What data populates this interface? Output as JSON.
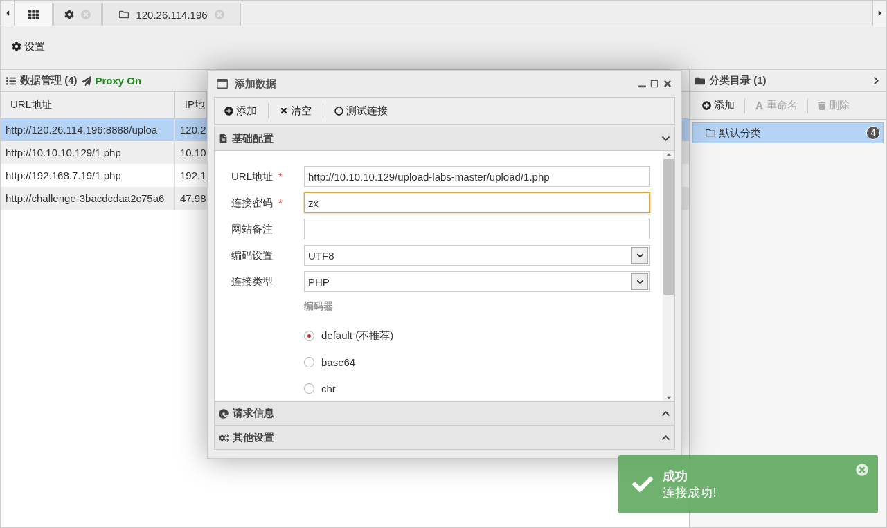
{
  "tabs": [
    {
      "kind": "home",
      "selected": true
    },
    {
      "kind": "settings",
      "selected": false,
      "closable": true
    },
    {
      "kind": "folder",
      "label": "120.26.114.196",
      "selected": false,
      "closable": true
    }
  ],
  "toolbar": {
    "buttons": [
      {
        "label": "设置"
      }
    ]
  },
  "data_panel": {
    "title": "数据管理 (4)",
    "proxy": "Proxy On",
    "columns": [
      "URL地址",
      "IP地"
    ],
    "rows": [
      {
        "cells": [
          "http://120.26.114.196:8888/uploa",
          "120.2"
        ],
        "selected": true
      },
      {
        "cells": [
          "http://10.10.10.129/1.php",
          "10.10"
        ],
        "selected": false
      },
      {
        "cells": [
          "http://192.168.7.19/1.php",
          "192.1"
        ],
        "selected": false
      },
      {
        "cells": [
          "http://challenge-3bacdcdaa2c75a6",
          "47.98"
        ],
        "selected": false
      }
    ]
  },
  "dialog": {
    "title": "添加数据",
    "toolbar": [
      {
        "kind": "add",
        "label": "添加"
      },
      {
        "kind": "clear",
        "label": "清空"
      },
      {
        "kind": "test",
        "label": "测试连接"
      }
    ],
    "sections": [
      {
        "kind": "file",
        "title": "基础配置",
        "expanded": true
      },
      {
        "kind": "request",
        "title": "请求信息",
        "expanded": false
      },
      {
        "kind": "gears",
        "title": "其他设置",
        "expanded": false
      }
    ],
    "fields": [
      {
        "kind": "text",
        "label": "URL地址",
        "required_mark": "*",
        "value": "http://10.10.10.129/upload-labs-master/upload/1.php",
        "focused": false
      },
      {
        "kind": "text",
        "label": "连接密码",
        "required_mark": "*",
        "value": "zx",
        "focused": true
      },
      {
        "kind": "text",
        "label": "网站备注",
        "focused": false
      },
      {
        "kind": "select",
        "label": "编码设置",
        "value": "UTF8",
        "focused": false
      },
      {
        "kind": "select",
        "label": "连接类型",
        "value": "PHP",
        "focused": false
      }
    ],
    "encoder": {
      "label": "编码器",
      "options": [
        {
          "label": "default (不推荐)",
          "selected": true
        },
        {
          "label": "base64",
          "selected": false
        },
        {
          "label": "chr",
          "selected": false
        }
      ]
    }
  },
  "category_panel": {
    "title": "分类目录 (1)",
    "toolbar": [
      {
        "kind": "add",
        "label": "添加",
        "disabled": false
      },
      {
        "kind": "rename",
        "label": "重命名",
        "disabled": true
      },
      {
        "kind": "delete",
        "label": "删除",
        "disabled": true
      }
    ],
    "items": [
      {
        "label": "默认分类",
        "count": "4",
        "selected": true
      }
    ]
  },
  "toast": {
    "title": "成功",
    "message": "连接成功!"
  }
}
